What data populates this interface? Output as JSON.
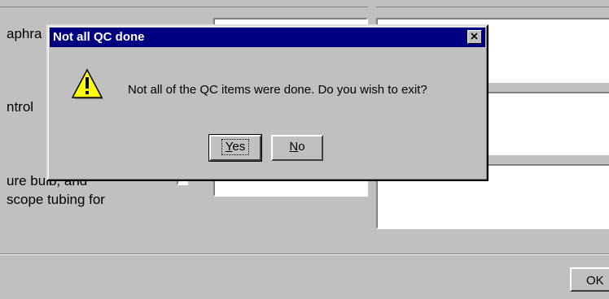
{
  "background": {
    "labels": [
      "aphra",
      "ntrol",
      "ure bulb, and",
      "scope tubing for"
    ],
    "ok_label": "OK"
  },
  "dialog": {
    "title": "Not all QC done",
    "message": "Not all of the QC items were done. Do you wish to exit?",
    "icon": "warning-icon",
    "buttons": {
      "yes": {
        "mnemonic": "Y",
        "rest": "es"
      },
      "no": {
        "mnemonic": "N",
        "rest": "o"
      }
    }
  },
  "colors": {
    "titlebar": "#000080",
    "face": "#c0c0c0",
    "warning_fill": "#ffff00"
  }
}
